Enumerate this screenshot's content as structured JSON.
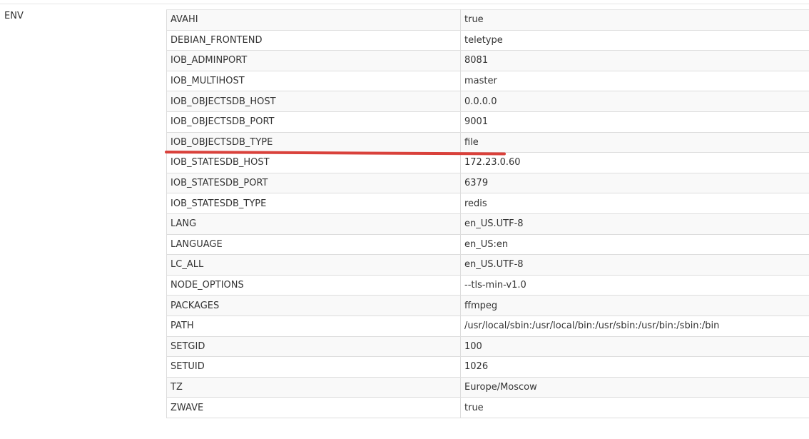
{
  "section": {
    "label": "ENV"
  },
  "env_vars": [
    {
      "key": "AVAHI",
      "value": "true"
    },
    {
      "key": "DEBIAN_FRONTEND",
      "value": "teletype"
    },
    {
      "key": "IOB_ADMINPORT",
      "value": "8081"
    },
    {
      "key": "IOB_MULTIHOST",
      "value": "master"
    },
    {
      "key": "IOB_OBJECTSDB_HOST",
      "value": "0.0.0.0"
    },
    {
      "key": "IOB_OBJECTSDB_PORT",
      "value": "9001"
    },
    {
      "key": "IOB_OBJECTSDB_TYPE",
      "value": "file"
    },
    {
      "key": "IOB_STATESDB_HOST",
      "value": "172.23.0.60"
    },
    {
      "key": "IOB_STATESDB_PORT",
      "value": "6379"
    },
    {
      "key": "IOB_STATESDB_TYPE",
      "value": "redis"
    },
    {
      "key": "LANG",
      "value": "en_US.UTF-8"
    },
    {
      "key": "LANGUAGE",
      "value": "en_US:en"
    },
    {
      "key": "LC_ALL",
      "value": "en_US.UTF-8"
    },
    {
      "key": "NODE_OPTIONS",
      "value": "--tls-min-v1.0"
    },
    {
      "key": "PACKAGES",
      "value": "ffmpeg"
    },
    {
      "key": "PATH",
      "value": "/usr/local/sbin:/usr/local/bin:/usr/sbin:/usr/bin:/sbin:/bin"
    },
    {
      "key": "SETGID",
      "value": "100"
    },
    {
      "key": "SETUID",
      "value": "1026"
    },
    {
      "key": "TZ",
      "value": "Europe/Moscow"
    },
    {
      "key": "ZWAVE",
      "value": "true"
    }
  ],
  "annotation": {
    "color": "#d9413b",
    "highlighted_key": "IOB_OBJECTSDB_TYPE"
  }
}
